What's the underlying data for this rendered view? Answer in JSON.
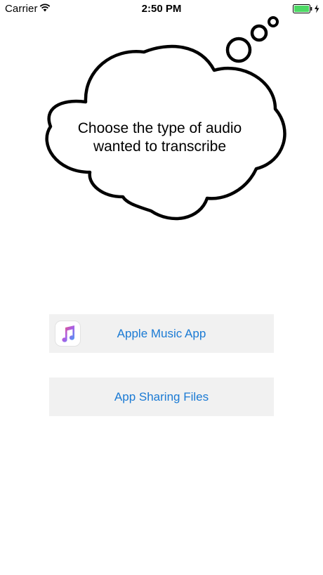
{
  "status_bar": {
    "carrier": "Carrier",
    "time": "2:50 PM",
    "battery_color": "#4cd964"
  },
  "prompt": {
    "line1": "Choose the type of audio",
    "line2": "wanted to transcribe"
  },
  "options": {
    "music_label": "Apple Music App",
    "sharing_label": "App Sharing Files"
  },
  "colors": {
    "button_background": "#f1f1f1",
    "button_text": "#1a7ad4"
  },
  "icons": {
    "music_app": "music-note-icon"
  }
}
